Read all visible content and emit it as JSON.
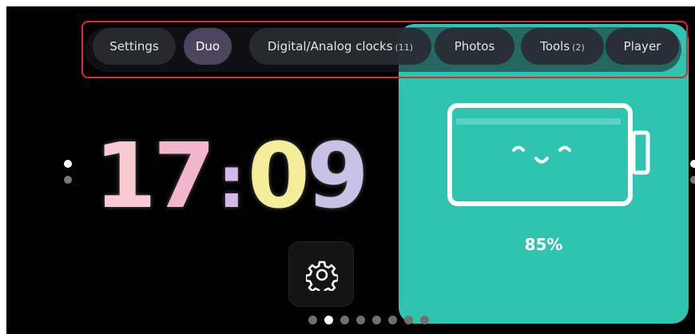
{
  "colors": {
    "background": "#000000",
    "battery_card": "#2ec4b0",
    "highlight_border": "#e3262c",
    "chip": "#2a2a32",
    "chip_selected": "#4d4560"
  },
  "tabs": [
    {
      "label": "Settings",
      "count": "",
      "selected": false
    },
    {
      "label": "Duo",
      "count": "",
      "selected": true
    },
    {
      "label": "Digital/Analog clocks",
      "count": "(11)",
      "selected": false
    },
    {
      "label": "Photos",
      "count": "",
      "selected": false
    },
    {
      "label": "Tools",
      "count": "(2)",
      "selected": false
    },
    {
      "label": "Player",
      "count": "",
      "selected": false
    }
  ],
  "clock": {
    "hour_tens": "1",
    "hour_ones": "7",
    "separator": ":",
    "minute_tens": "0",
    "minute_ones": "9"
  },
  "battery": {
    "percent_label": "85%",
    "level": 0.85,
    "face": "smiley"
  },
  "settings_button": {
    "icon": "gear-icon"
  },
  "pager": {
    "total": 8,
    "active_index": 1
  }
}
